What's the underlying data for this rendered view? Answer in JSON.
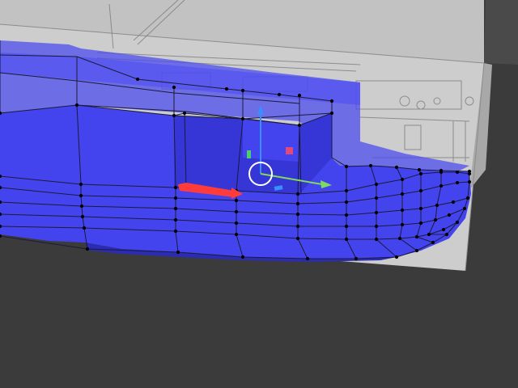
{
  "viewport": {
    "mode": "edit",
    "colors": {
      "background": "#3b3b3b",
      "reference_plane": "#c7c7c7",
      "reference_plane_side": "#a9a9a9",
      "mesh_face": "#4848f0",
      "mesh_face_dark": "#3a3ad8",
      "mesh_edge": "#1a1a3a",
      "vertex": "#000000",
      "gizmo_x": "#ff3b3b",
      "gizmo_y": "#7fdc5a",
      "gizmo_z": "#3a8fff",
      "gizmo_ring": "#ffffff",
      "gizmo_plane_yz": "#4ad16b",
      "gizmo_plane_xz": "#e04a7a",
      "grid_axis_y": "#7ab34a",
      "grid_axis_x": "#c85050"
    },
    "gizmo": {
      "type": "move-gizmo",
      "axes": [
        "x-axis-arrow",
        "y-axis-arrow",
        "z-axis-arrow"
      ]
    },
    "background_image": "ship-blueprint-reference"
  }
}
